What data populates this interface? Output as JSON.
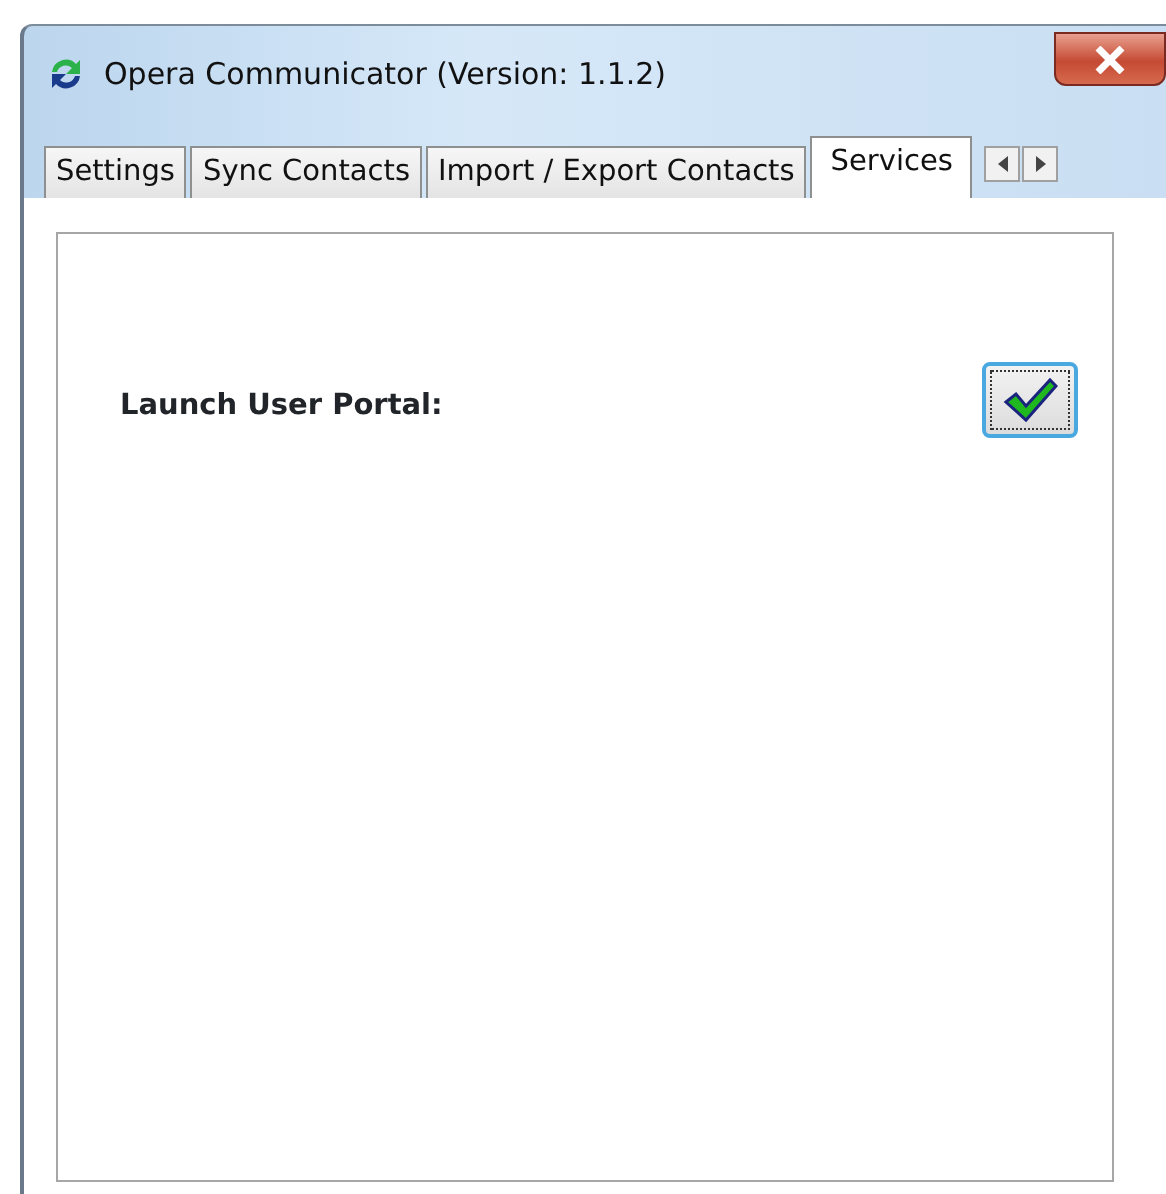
{
  "window": {
    "title": "Opera Communicator (Version: 1.1.2)"
  },
  "tabs": [
    {
      "label": "Settings",
      "selected": false
    },
    {
      "label": "Sync Contacts",
      "selected": false
    },
    {
      "label": "Import / Export Contacts",
      "selected": false
    },
    {
      "label": "Services",
      "selected": true
    }
  ],
  "services": [
    {
      "label": "Launch User Portal:",
      "checked": true
    }
  ]
}
